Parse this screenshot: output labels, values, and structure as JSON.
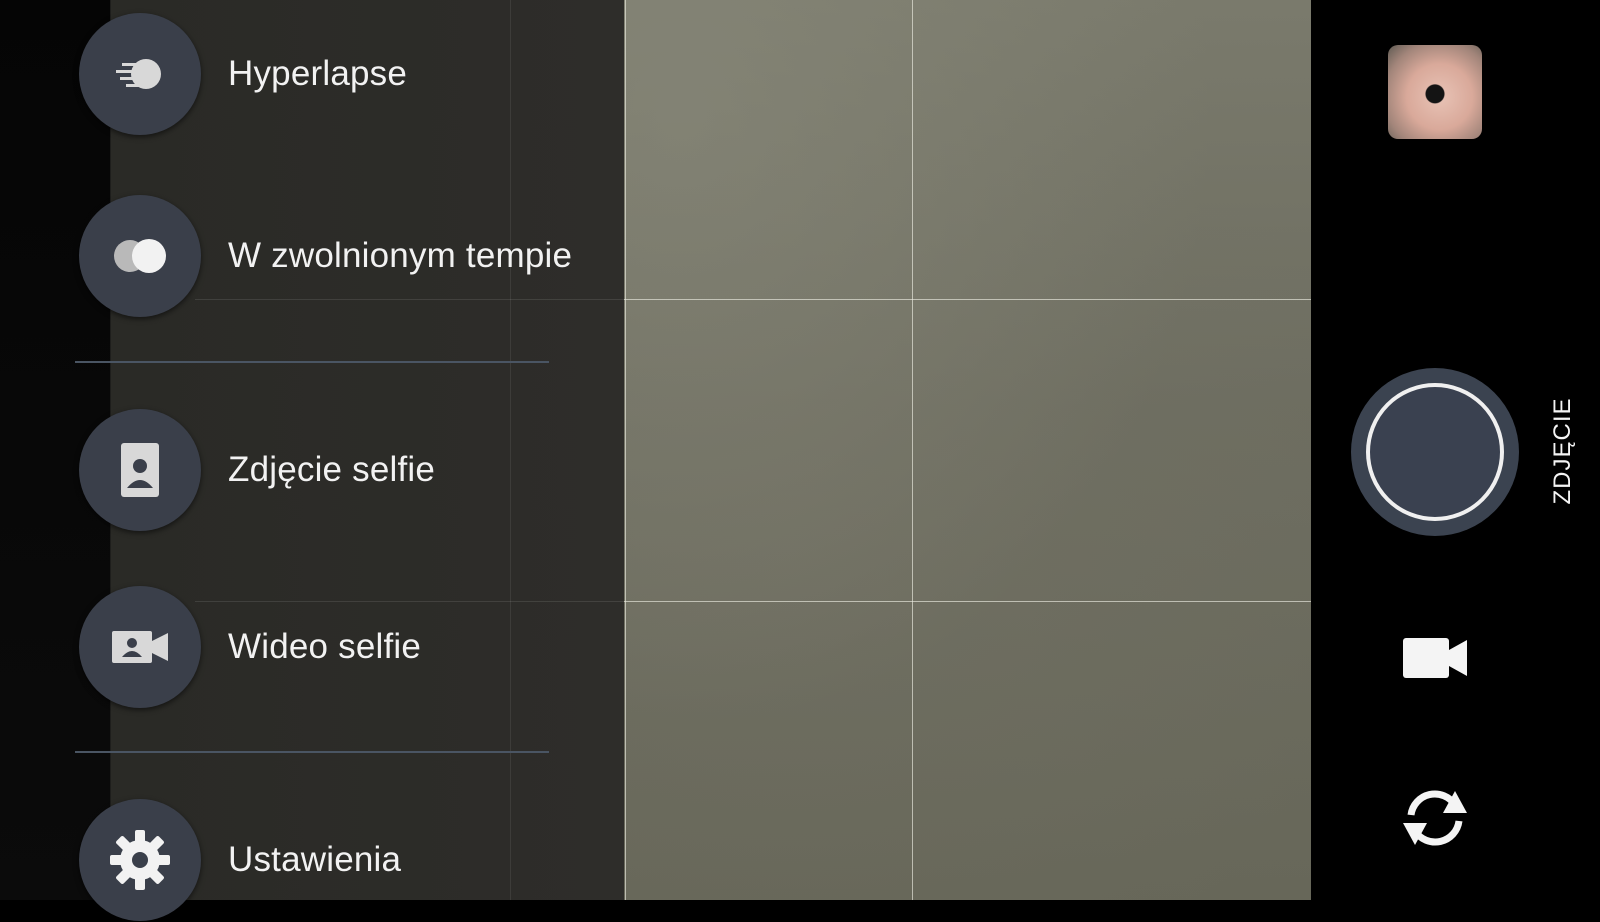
{
  "menu": {
    "items": [
      {
        "label": "Hyperlapse",
        "icon": "hyperlapse-icon"
      },
      {
        "label": "W zwolnionym tempie",
        "icon": "slow-motion-icon"
      },
      {
        "label": "Zdjęcie selfie",
        "icon": "selfie-photo-icon"
      },
      {
        "label": "Wideo selfie",
        "icon": "selfie-video-icon"
      },
      {
        "label": "Ustawienia",
        "icon": "gear-icon"
      }
    ]
  },
  "controls": {
    "current_mode": "ZDJĘCIE",
    "gallery_icon": "gallery-thumbnail",
    "shutter_icon": "shutter-icon",
    "video_icon": "video-camera-icon",
    "switch_icon": "switch-camera-icon"
  },
  "colors": {
    "menu_circle": "#3a3f4a",
    "shutter": "#3b4350",
    "divider": "#4a5563"
  }
}
